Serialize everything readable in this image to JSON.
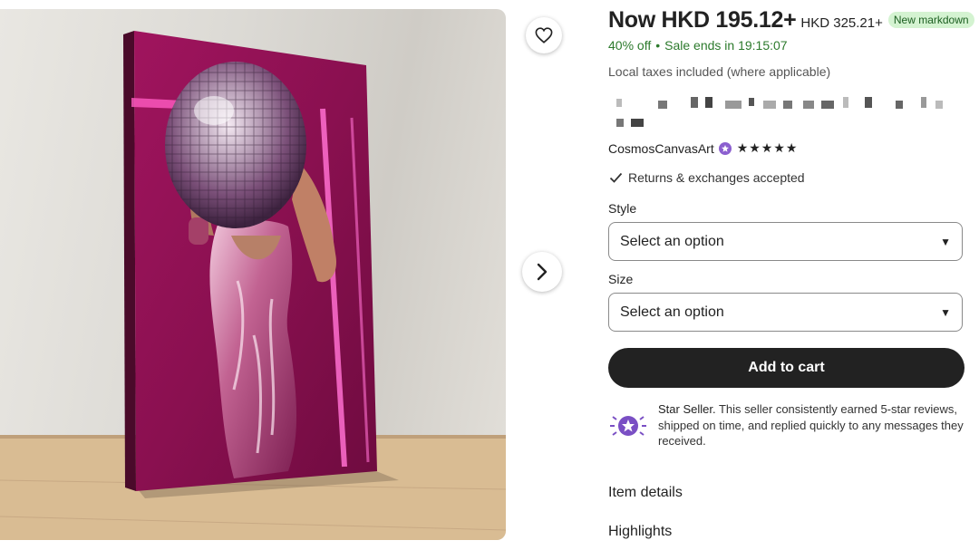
{
  "product": {
    "image_alt": "Canvas print of a woman with a disco-ball head in a sparkly magenta dress"
  },
  "pricing": {
    "now": "Now HKD 195.12+",
    "original": "HKD 325.21+",
    "badge": "New markdown",
    "discount": "40% off",
    "sale_ends": "Sale ends in 19:15:07",
    "taxes": "Local taxes included (where applicable)"
  },
  "seller": {
    "name": "CosmosCanvasArt",
    "rating_stars": "★★★★★",
    "rating": 5
  },
  "policies": {
    "returns": "Returns & exchanges accepted"
  },
  "options": {
    "style_label": "Style",
    "style_value": "Select an option",
    "size_label": "Size",
    "size_value": "Select an option"
  },
  "actions": {
    "add_to_cart": "Add to cart"
  },
  "star_seller": {
    "title": "Star Seller.",
    "text": " This seller consistently earned 5-star reviews, shipped on time, and replied quickly to any messages they received."
  },
  "sections": {
    "item_details": "Item details",
    "highlights": "Highlights"
  },
  "icons": {
    "favorite": "heart-icon",
    "next": "chevron-right-icon",
    "verified": "verified-badge-icon",
    "check": "check-icon",
    "caret": "caret-down-icon",
    "star_seller": "star-seller-icon"
  },
  "colors": {
    "sale_green": "#2c7a2c",
    "badge_bg": "#d4f3d1",
    "cart_bg": "#222222",
    "seller_purple": "#8b5fcf"
  }
}
